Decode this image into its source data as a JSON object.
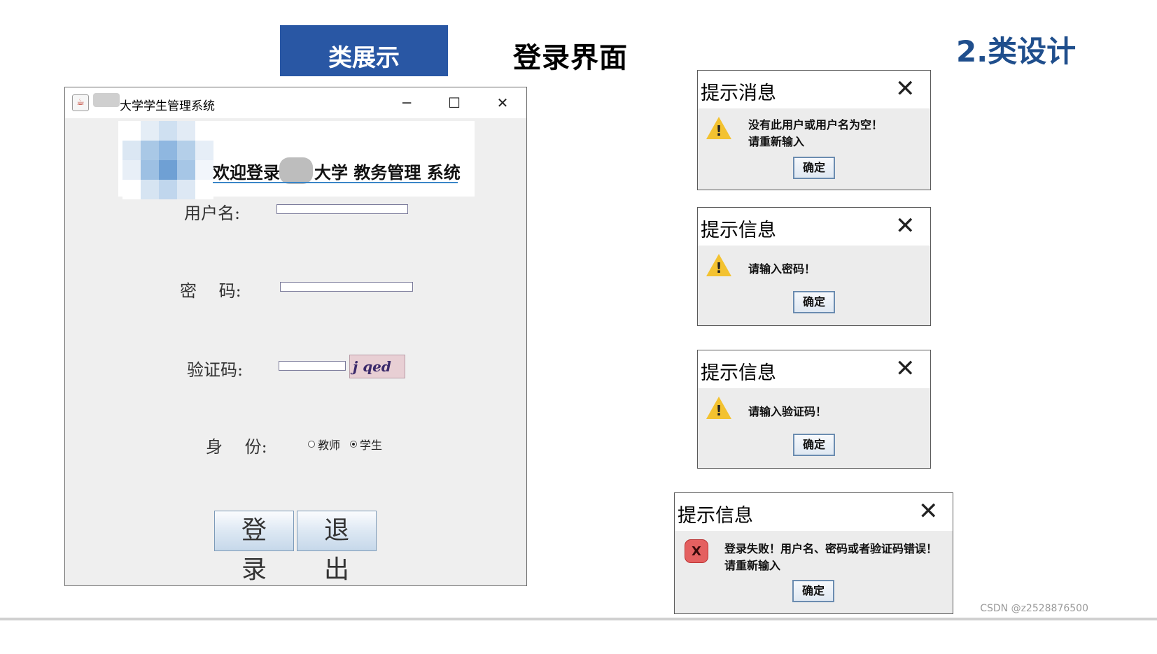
{
  "slide": {
    "tab_label": "类展示",
    "subtitle": "登录界面",
    "section": "2.类设计",
    "watermark": "CSDN @z2528876500"
  },
  "login_window": {
    "title": "大学学生管理系统",
    "minimize_glyph": "─",
    "maximize_glyph": "☐",
    "close_glyph": "✕",
    "banner_welcome": "欢迎登录",
    "banner_rest": "大学 教务管理 系统",
    "username_label": "用户名:",
    "password_label": "密　 码:",
    "captcha_label": "验证码:",
    "captcha_text": "j qed",
    "identity_label": "身　 份:",
    "roles": [
      {
        "label": "教师",
        "selected": false
      },
      {
        "label": "学生",
        "selected": true
      }
    ],
    "username_value": "",
    "password_value": "",
    "captcha_value": "",
    "login_button": "登录",
    "exit_button": "退出"
  },
  "dialogs": [
    {
      "title": "提示消息",
      "icon": "warning-icon",
      "lines": [
        "没有此用户或用户名为空！",
        "请重新输入"
      ],
      "ok": "确定",
      "close": "✕"
    },
    {
      "title": "提示信息",
      "icon": "warning-icon",
      "lines": [
        "请输入密码！"
      ],
      "ok": "确定",
      "close": "✕"
    },
    {
      "title": "提示信息",
      "icon": "warning-icon",
      "lines": [
        "请输入验证码！"
      ],
      "ok": "确定",
      "close": "✕"
    },
    {
      "title": "提示信息",
      "icon": "error-icon",
      "lines": [
        "登录失败！用户名、密码或者验证码错误！",
        "请重新输入"
      ],
      "ok": "确定",
      "close": "✕",
      "error_mark": "X"
    }
  ],
  "colors": {
    "tab_blue": "#2957a4",
    "section_blue": "#1f4e8c",
    "warning_yellow": "#f3c230",
    "error_red": "#e46060"
  }
}
